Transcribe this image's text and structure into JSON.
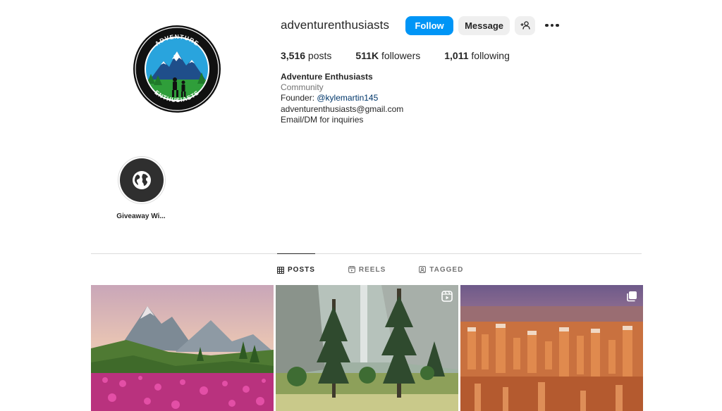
{
  "profile": {
    "username": "adventurenthusiasts",
    "follow_label": "Follow",
    "message_label": "Message",
    "logo_text_top": "ADVENTURE",
    "logo_text_bottom": "ENTHUSIASTS"
  },
  "stats": {
    "posts_count": "3,516",
    "posts_label": " posts",
    "followers_count": "511K",
    "followers_label": " followers",
    "following_count": "1,011",
    "following_label": " following"
  },
  "bio": {
    "name": "Adventure Enthusiasts",
    "category": "Community",
    "founder_prefix": "Founder: ",
    "founder_handle": "@kylemartin145",
    "email": "adventurenthusiasts@gmail.com",
    "note": "Email/DM for inquiries"
  },
  "highlights": [
    {
      "label": "Giveaway Wi...",
      "icon": "globe-icon"
    }
  ],
  "tabs": [
    {
      "label": "POSTS",
      "icon": "grid-icon",
      "active": true
    },
    {
      "label": "REELS",
      "icon": "reels-icon",
      "active": false
    },
    {
      "label": "TAGGED",
      "icon": "tagged-icon",
      "active": false
    }
  ],
  "posts": [
    {
      "kind": "image",
      "subject": "mountain with pink wildflowers"
    },
    {
      "kind": "reel",
      "subject": "tall pine trees in valley",
      "badge_icon": "reels-icon"
    },
    {
      "kind": "carousel",
      "subject": "red rock hoodoo canyon",
      "badge_icon": "carousel-icon"
    }
  ],
  "colors": {
    "accent": "#0095f6",
    "button_gray": "#efefef",
    "text": "#262626",
    "secondary": "#737373",
    "link": "#00376b",
    "divider": "#dbdbdb"
  }
}
